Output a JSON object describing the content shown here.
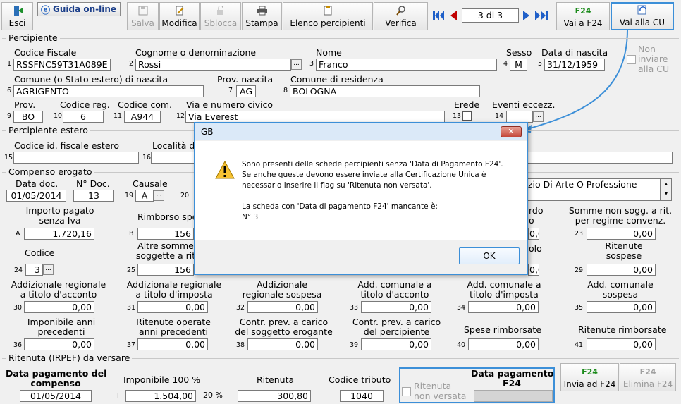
{
  "toolbar": {
    "esci": "Esci",
    "guida": "Guida on-line",
    "salva": "Salva",
    "modifica": "Modifica",
    "sblocca": "Sblocca",
    "stampa": "Stampa",
    "elenco": "Elenco percipienti",
    "verifica": "Verifica",
    "pager": "3 di 3",
    "vai_f24": "Vai a F24",
    "vai_cu": "Vai alla CU"
  },
  "percipiente": {
    "title": "Percipiente",
    "cf_label": "Codice Fiscale",
    "cf_num": "1",
    "cf_value": "RSSFNC59T31A089E",
    "cognome_label": "Cognome o denominazione",
    "cognome_num": "2",
    "cognome_value": "Rossi",
    "nome_label": "Nome",
    "nome_num": "3",
    "nome_value": "Franco",
    "sesso_label": "Sesso",
    "sesso_num": "4",
    "sesso_value": "M",
    "nascita_label": "Data di nascita",
    "nascita_num": "5",
    "nascita_value": "31/12/1959",
    "non_inviare": "Non\ninviare\nalla CU",
    "comune_nascita_label": "Comune (o Stato estero) di nascita",
    "comune_nascita_num": "6",
    "comune_nascita_value": "AGRIGENTO",
    "prov_nascita_label": "Prov. nascita",
    "prov_nascita_num": "7",
    "prov_nascita_value": "AG",
    "comune_res_label": "Comune di residenza",
    "comune_res_num": "8",
    "comune_res_value": "BOLOGNA",
    "prov_label": "Prov.",
    "prov_num": "9",
    "prov_value": "BO",
    "codreg_label": "Codice reg.",
    "codreg_num": "10",
    "codreg_value": "6",
    "codcom_label": "Codice com.",
    "codcom_num": "11",
    "codcom_value": "A944",
    "via_label": "Via e numero civico",
    "via_num": "12",
    "via_value": "Via Everest",
    "erede_label": "Erede",
    "erede_num": "13",
    "eventi_label": "Eventi eccezz.",
    "eventi_num": "14"
  },
  "estero": {
    "title": "Percipiente estero",
    "cod_label": "Codice id. fiscale estero",
    "cod_num": "15",
    "loc_label": "Località d",
    "loc_num": "16"
  },
  "compenso": {
    "title": "Compenso erogato",
    "data_doc_label": "Data doc.",
    "data_doc_value": "01/05/2014",
    "ndoc_label": "N° Doc.",
    "ndoc_value": "13",
    "causale_label": "Causale",
    "causale_num": "19",
    "causale_value": "A",
    "n20": "20",
    "desc_value": "zio Di Arte O Professione",
    "importo_label": "Importo pagato\nsenza Iva",
    "importo_num": "A",
    "importo_value": "1.720,16",
    "rimborso_label": "Rimborso spe",
    "rimborso_num": "B",
    "rimborso_value": "156",
    "accordo_label": "rdo\no",
    "accordo_value": "0,00",
    "somme_label": "Somme non sogg. a rit.\nper regime convenz.",
    "somme_num": "23",
    "somme_value": "0,00",
    "codice_label": "Codice",
    "codice_num": "24",
    "codice_value": "3",
    "altre_label": "Altre somme\nsoggette a rit",
    "altre_num": "25",
    "altre_value": "156",
    "olo_label": "olo",
    "olo_value": "0,00",
    "sospese_label": "Ritenute\nsospese",
    "sospese_num": "29",
    "sospese_value": "0,00",
    "r30_label": "Addizionale regionale\na titolo d'acconto",
    "r30_num": "30",
    "r30_value": "0,00",
    "r31_label": "Addizionale regionale\na titolo d'imposta",
    "r31_num": "31",
    "r31_value": "0,00",
    "r32_label": "Addizionale\nregionale sospesa",
    "r32_num": "32",
    "r32_value": "0,00",
    "r33_label": "Add. comunale a\ntitolo d'acconto",
    "r33_num": "33",
    "r33_value": "0,00",
    "r34_label": "Add. comunale a\ntitolo d'imposta",
    "r34_num": "34",
    "r34_value": "0,00",
    "r35_label": "Add. comunale\nsospesa",
    "r35_num": "35",
    "r35_value": "0,00",
    "r36_label": "Imponibile anni\nprecedenti",
    "r36_num": "36",
    "r36_value": "0,00",
    "r37_label": "Ritenute operate\nanni precedenti",
    "r37_num": "37",
    "r37_value": "0,00",
    "r38_label": "Contr. prev. a carico\ndel soggetto erogante",
    "r38_num": "38",
    "r38_value": "0,00",
    "r39_label": "Contr. prev. a carico\ndel percipiente",
    "r39_num": "39",
    "r39_value": "0,00",
    "r40_label": "Spese rimborsate",
    "r40_num": "40",
    "r40_value": "0,00",
    "r41_label": "Ritenute rimborsate",
    "r41_num": "41",
    "r41_value": "0,00"
  },
  "ritenuta": {
    "title": "Ritenuta (IRPEF) da versare",
    "data_label": "Data pagamento del\ncompenso",
    "data_value": "01/05/2014",
    "imponibile_label": "Imponibile 100 %",
    "imponibile_num": "L",
    "imponibile_value": "1.504,00",
    "perc": "20 %",
    "ritenuta_label": "Ritenuta",
    "ritenuta_value": "300,80",
    "codtrib_label": "Codice tributo",
    "codtrib_value": "1040",
    "non_versata": "Ritenuta\nnon versata",
    "data_f24_label": "Data pagamento\nF24",
    "invia_f24": "Invia ad F24",
    "elimina_f24": "Elimina F24"
  },
  "dialog": {
    "title": "GB",
    "message": "Sono presenti delle schede percipienti senza 'Data di Pagamento F24'.\nSe anche queste devono essere inviate alla Certificazione Unica è\nnecessario inserire il flag su 'Ritenuta non versata'.\n\nLa scheda con 'Data di pagamento F24' mancante è:\nN° 3",
    "ok": "OK"
  },
  "colors": {
    "accent": "#3c8fd8",
    "nav": "#1f5fc8",
    "prev": "#c00000"
  },
  "icons": [
    "exit-icon",
    "help-icon",
    "save-icon",
    "edit-icon",
    "unlock-icon",
    "print-icon",
    "list-icon",
    "verify-icon",
    "first-icon",
    "prev-icon",
    "next-icon",
    "last-icon",
    "f24-icon",
    "cu-icon",
    "warning-icon"
  ]
}
